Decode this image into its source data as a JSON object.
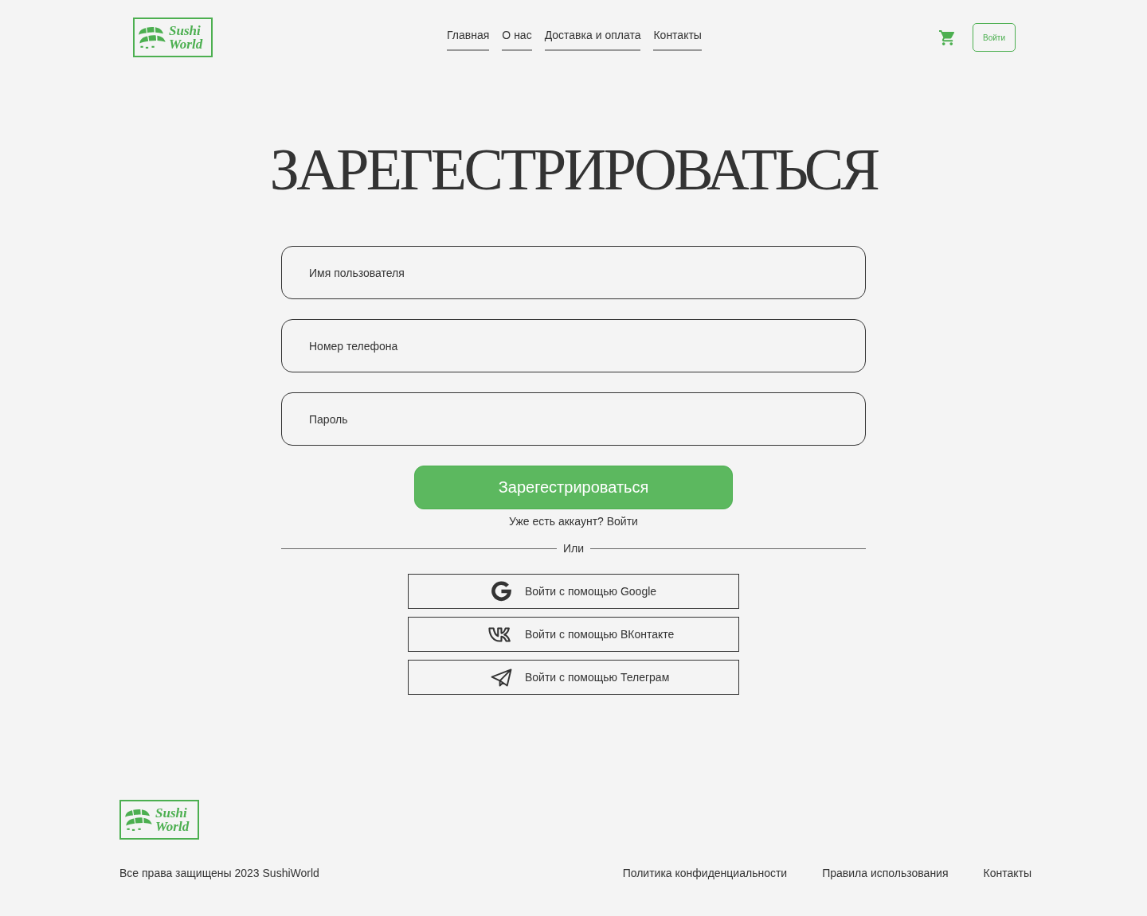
{
  "header": {
    "logo": {
      "lines": [
        "Sushi",
        "World"
      ]
    },
    "nav": [
      "Главная",
      "О нас",
      "Доставка и оплата",
      "Контакты"
    ],
    "login_button": "Войти"
  },
  "title": "ЗАРЕГЕСТРИРОВАТЬСЯ",
  "form": {
    "fields": [
      {
        "placeholder": "Имя пользователя"
      },
      {
        "placeholder": "Номер телефона"
      },
      {
        "placeholder": "Пароль"
      }
    ],
    "submit": "Зарегестрироваться",
    "login_prompt": {
      "text": "Уже есть аккаунт?",
      "link": "Войти"
    },
    "divider": "Или",
    "social": [
      {
        "kind": "google",
        "label": "Войти с помощью Google"
      },
      {
        "kind": "vk",
        "label": "Войти с помощью ВКонтакте"
      },
      {
        "kind": "telegram",
        "label": "Войти с помощью Телеграм"
      }
    ]
  },
  "footer": {
    "logo": {
      "lines": [
        "Sushi",
        "World"
      ]
    },
    "copyright": "Все права защищены 2023 SushiWorld",
    "links": [
      "Политика конфиденциальности",
      "Правила использования",
      "Контакты"
    ]
  }
}
